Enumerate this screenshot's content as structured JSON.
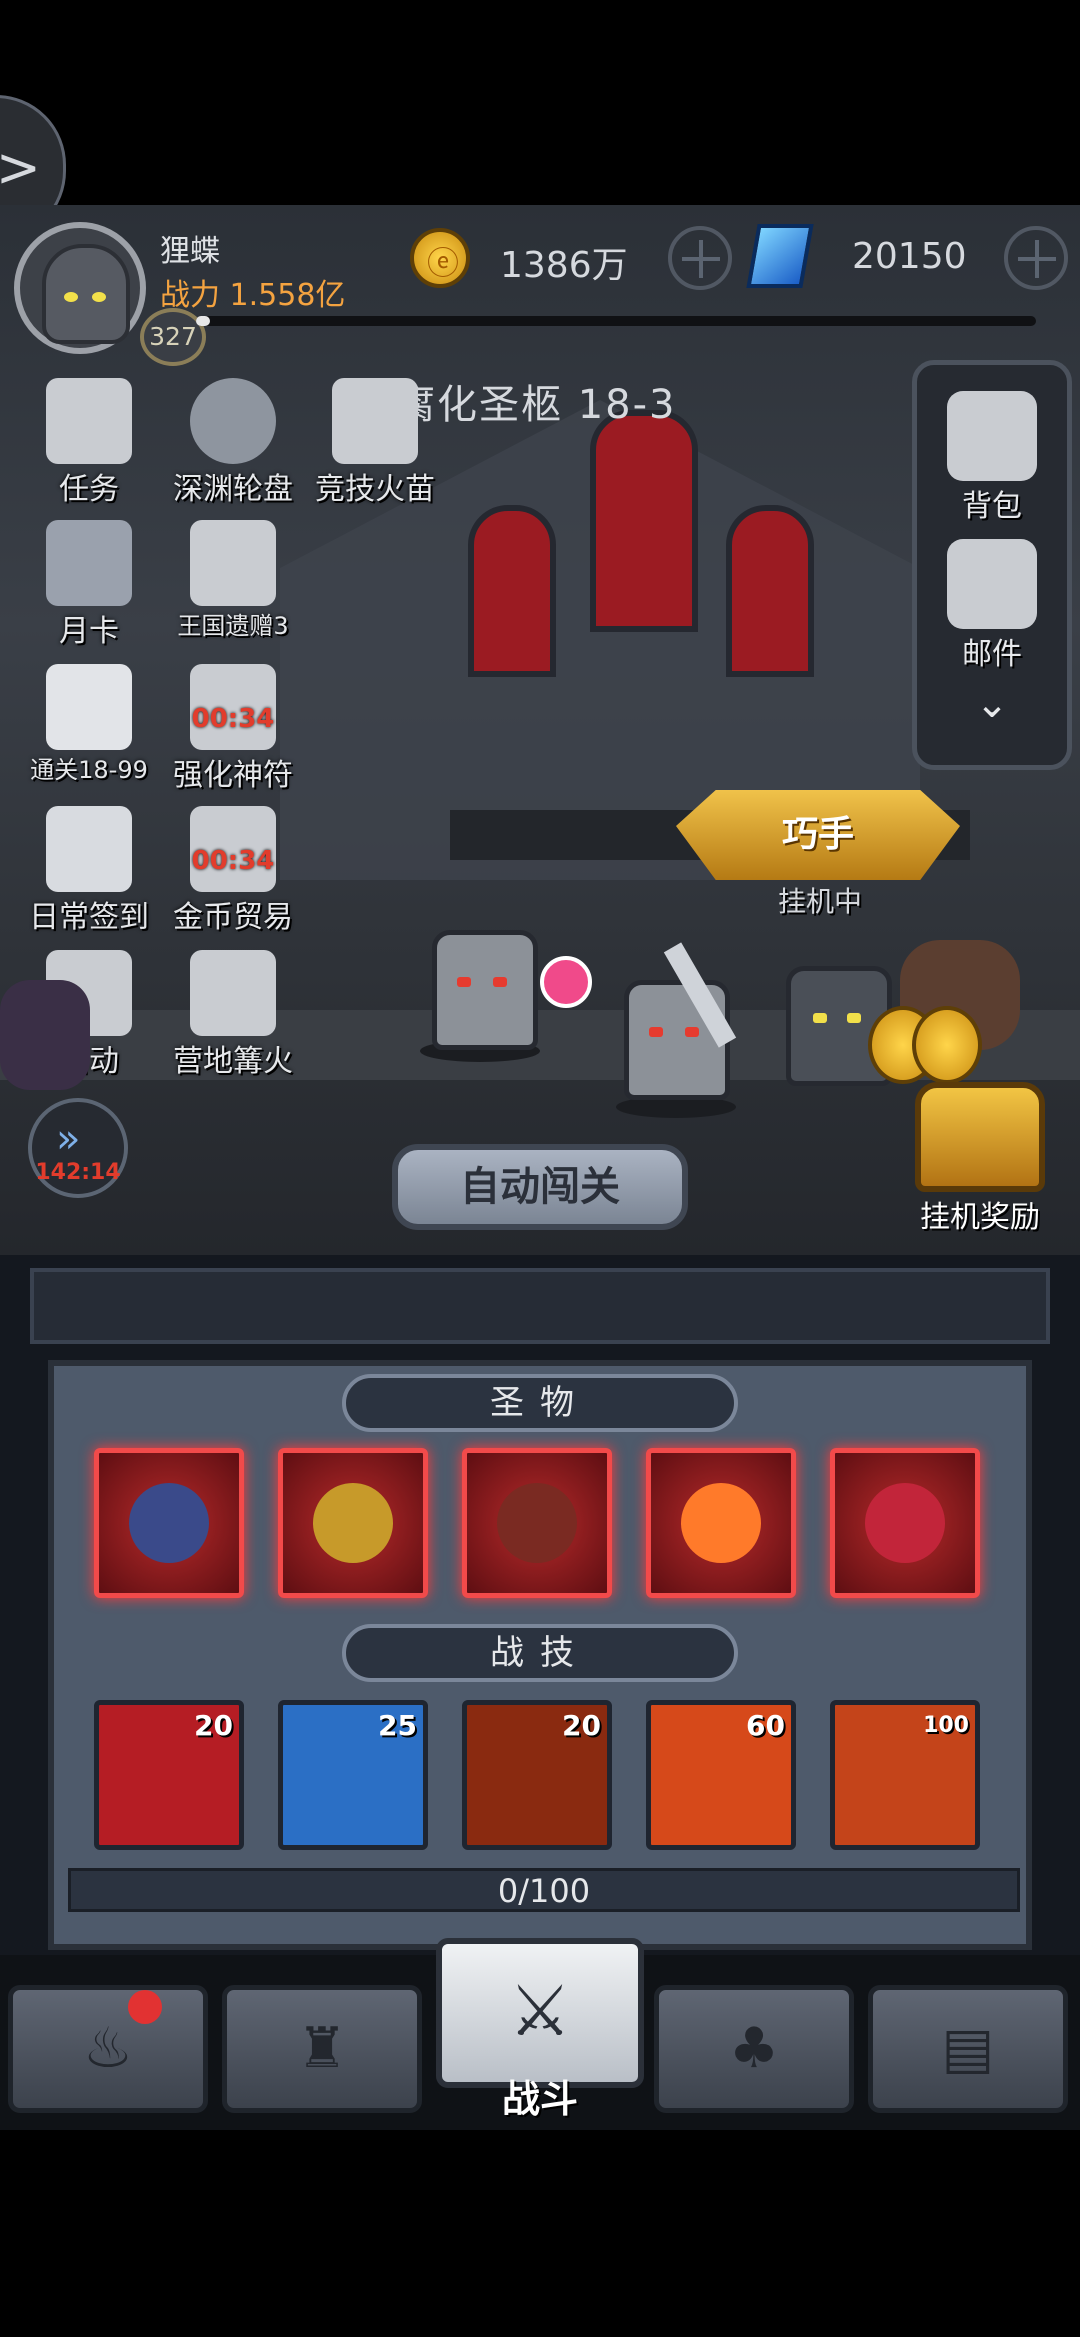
{
  "player": {
    "name": "狸蝶",
    "power_label": "战力",
    "power_value": "1.558亿",
    "level": "327"
  },
  "currency": {
    "gold": "1386万",
    "gems": "20150"
  },
  "stage": {
    "title": "腐化圣柩 18-3"
  },
  "left_menu": [
    {
      "label": "任务",
      "icon": "scroll-icon",
      "timer": ""
    },
    {
      "label": "深渊轮盘",
      "icon": "wheel-icon",
      "timer": ""
    },
    {
      "label": "竞技火苗",
      "icon": "locked-icon",
      "timer": ""
    },
    {
      "label": "月卡",
      "icon": "card-icon",
      "timer": ""
    },
    {
      "label": "王国遗赠3",
      "icon": "locked-icon",
      "timer": ""
    },
    {
      "label": "通关18-99",
      "icon": "gift-icon",
      "timer": ""
    },
    {
      "label": "强化神符",
      "icon": "locked-icon",
      "timer": "00:34"
    },
    {
      "label": "日常签到",
      "icon": "scroll-pen-icon",
      "timer": ""
    },
    {
      "label": "金币贸易",
      "icon": "locked-icon",
      "timer": "00:34"
    },
    {
      "label": "活动",
      "icon": "locked-icon",
      "timer": ""
    },
    {
      "label": "营地篝火",
      "icon": "locked-icon",
      "timer": ""
    }
  ],
  "right_menu": [
    {
      "label": "背包",
      "icon": "backpack-icon"
    },
    {
      "label": "邮件",
      "icon": "mailbox-icon"
    }
  ],
  "battle": {
    "banner": "巧手",
    "idle_status": "挂机中",
    "speed_timer": "142:14",
    "auto_button": "自动闯关",
    "idle_reward_label": "挂机奖励"
  },
  "relics": {
    "title": "圣物",
    "items": [
      {
        "name": "horn-relic",
        "color": "#3a4a8a"
      },
      {
        "name": "dragon-relic",
        "color": "#c79a2a"
      },
      {
        "name": "shield-relic",
        "color": "#7a2a22"
      },
      {
        "name": "fire-relic",
        "color": "#ff7a2a"
      },
      {
        "name": "orb-relic",
        "color": "#c2253a"
      }
    ]
  },
  "skills": {
    "title": "战技",
    "items": [
      {
        "name": "blade-skill",
        "cost": "20",
        "bg": "#b51d24"
      },
      {
        "name": "boot-skill",
        "cost": "25",
        "bg": "#2b6fc5"
      },
      {
        "name": "demon-skill",
        "cost": "20",
        "bg": "#8a2a10"
      },
      {
        "name": "burst-skill",
        "cost": "60",
        "bg": "#d6491a"
      },
      {
        "name": "dragon-skill",
        "cost": "100",
        "bg": "#c4441a"
      }
    ],
    "progress": "0/100"
  },
  "nav": {
    "active_label": "战斗"
  }
}
